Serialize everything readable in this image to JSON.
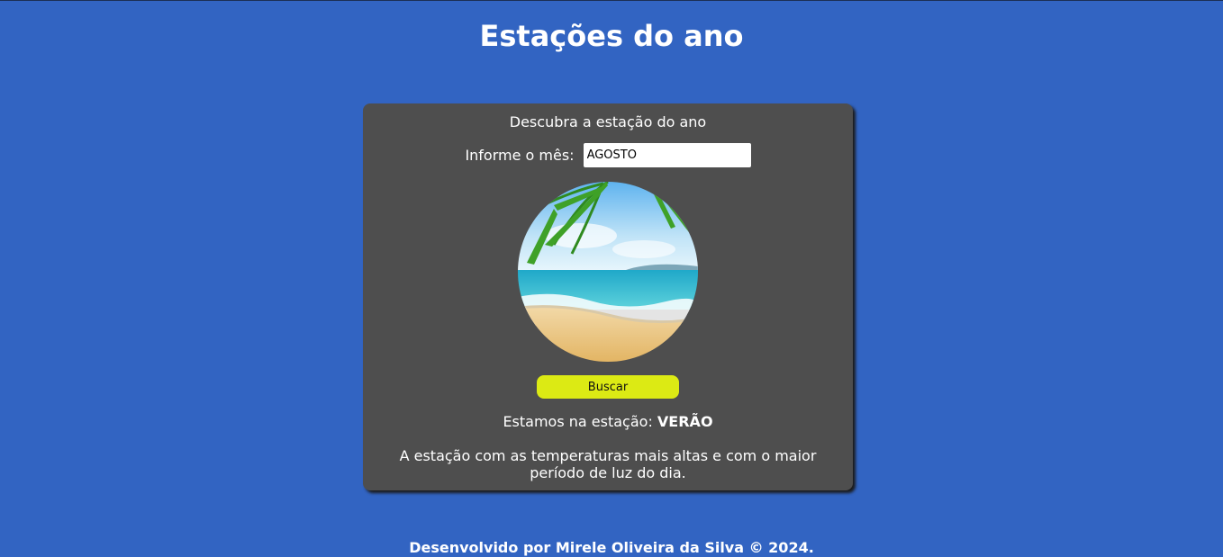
{
  "header": {
    "title": "Estações do ano"
  },
  "card": {
    "heading": "Descubra a estação do ano",
    "month_label": "Informe o mês:",
    "month_value": "AGOSTO",
    "search_label": "Buscar",
    "result_prefix": "Estamos na estação:",
    "result_season": "VERÃO",
    "description": "A estação com as temperaturas mais altas e com o maior período de luz do dia."
  },
  "footer": {
    "text": "Desenvolvido por Mirele Oliveira da Silva © 2024."
  },
  "colors": {
    "background": "#3264c2",
    "card": "#4e4e4e",
    "button": "#dcea14"
  }
}
